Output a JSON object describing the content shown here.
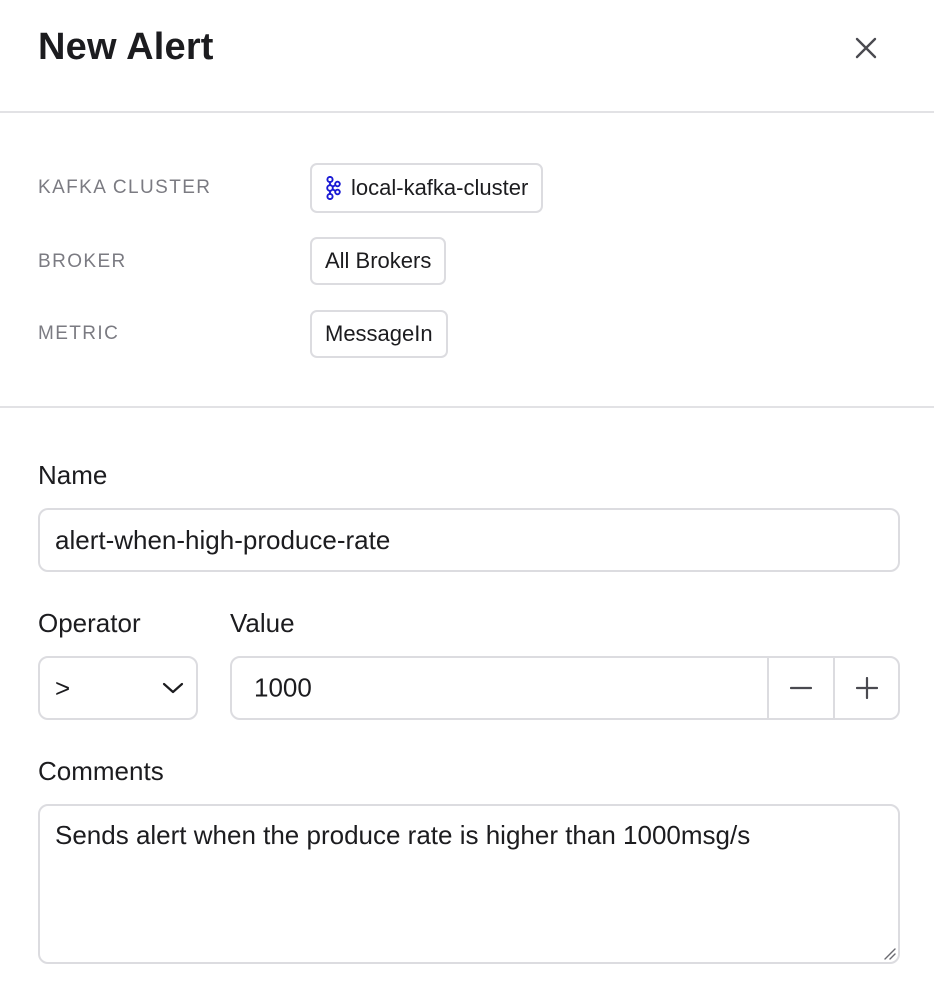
{
  "header": {
    "title": "New Alert"
  },
  "info": {
    "cluster_label": "KAFKA CLUSTER",
    "cluster_value": "local-kafka-cluster",
    "broker_label": "BROKER",
    "broker_value": "All Brokers",
    "metric_label": "METRIC",
    "metric_value": "MessageIn"
  },
  "form": {
    "name_label": "Name",
    "name_value": "alert-when-high-produce-rate",
    "operator_label": "Operator",
    "operator_value": ">",
    "value_label": "Value",
    "value_value": "1000",
    "comments_label": "Comments",
    "comments_value": "Sends alert when the produce rate is higher than 1000msg/s"
  },
  "colors": {
    "kafka_icon": "#1a1ad4",
    "border": "#dcdce0",
    "divider": "#e2e2e5",
    "muted_text": "#7b7b82"
  },
  "icons": {
    "close": "close-icon",
    "kafka": "kafka-icon",
    "chevron": "chevron-down-icon",
    "minus": "minus-icon",
    "plus": "plus-icon"
  }
}
